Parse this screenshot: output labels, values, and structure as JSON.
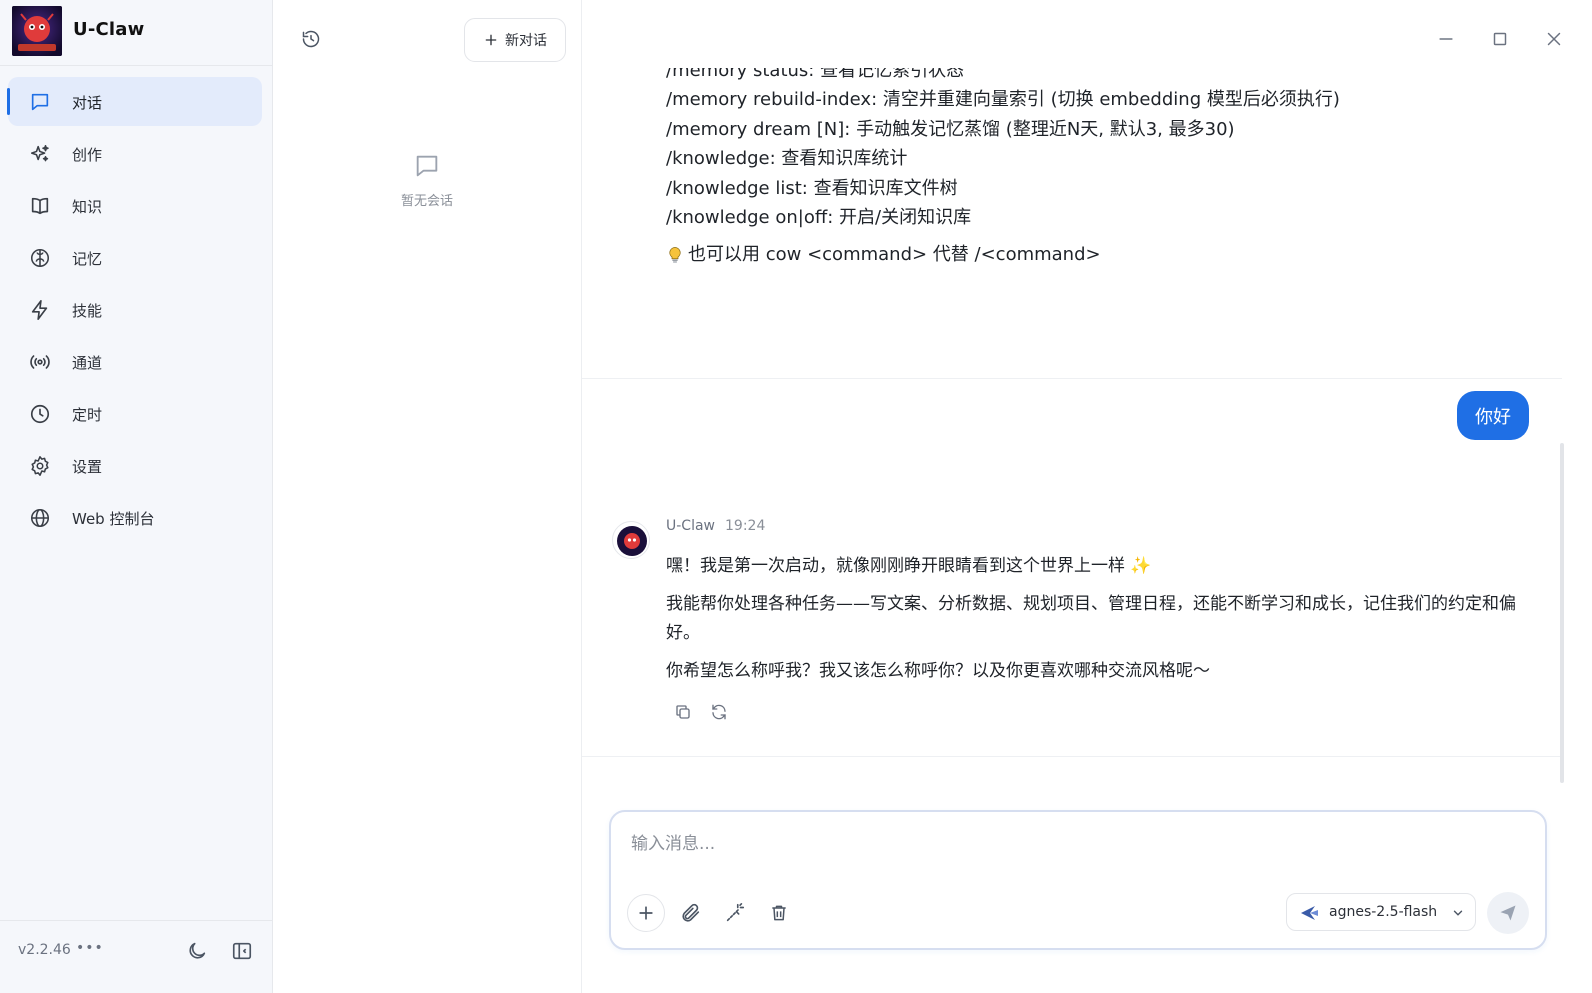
{
  "app": {
    "name": "U-Claw",
    "version": "v2.2.46"
  },
  "sidebar": {
    "items": [
      {
        "label": "对话",
        "icon": "chat-icon",
        "active": true
      },
      {
        "label": "创作",
        "icon": "sparkles-icon",
        "active": false
      },
      {
        "label": "知识",
        "icon": "book-icon",
        "active": false
      },
      {
        "label": "记忆",
        "icon": "brain-icon",
        "active": false
      },
      {
        "label": "技能",
        "icon": "bolt-icon",
        "active": false
      },
      {
        "label": "通道",
        "icon": "broadcast-icon",
        "active": false
      },
      {
        "label": "定时",
        "icon": "clock-icon",
        "active": false
      },
      {
        "label": "设置",
        "icon": "gear-icon",
        "active": false
      },
      {
        "label": "Web 控制台",
        "icon": "globe-icon",
        "active": false
      }
    ],
    "more": "•••"
  },
  "sessions": {
    "new_chat_label": "新对话",
    "empty_text": "暂无会话"
  },
  "chat": {
    "help_lines": [
      "/memory status: 查看记忆索引状态",
      "/memory rebuild-index: 清空并重建向量索引 (切换 embedding 模型后必须执行)",
      "/memory dream [N]: 手动触发记忆蒸馏 (整理近N天, 默认3, 最多30)",
      "/knowledge: 查看知识库统计",
      "/knowledge list: 查看知识库文件树",
      "/knowledge on|off: 开启/关闭知识库"
    ],
    "help_tip": "也可以用 cow <command> 代替 /<command>",
    "user_message": "你好",
    "bot": {
      "name": "U-Claw",
      "time": "19:24",
      "paragraphs": [
        "嘿！我是第一次启动，就像刚刚睁开眼睛看到这个世界上一样 ✨",
        "我能帮你处理各种任务——写文案、分析数据、规划项目、管理日程，还能不断学习和成长，记住我们的约定和偏好。",
        "你希望怎么称呼我？我又该怎么称呼你？以及你更喜欢哪种交流风格呢～"
      ]
    }
  },
  "composer": {
    "placeholder": "输入消息...",
    "model": "agnes-2.5-flash"
  },
  "colors": {
    "accent": "#1f6fe5",
    "active_nav_bg": "#e3ebfb",
    "sidebar_bg": "#f5f7fb"
  }
}
